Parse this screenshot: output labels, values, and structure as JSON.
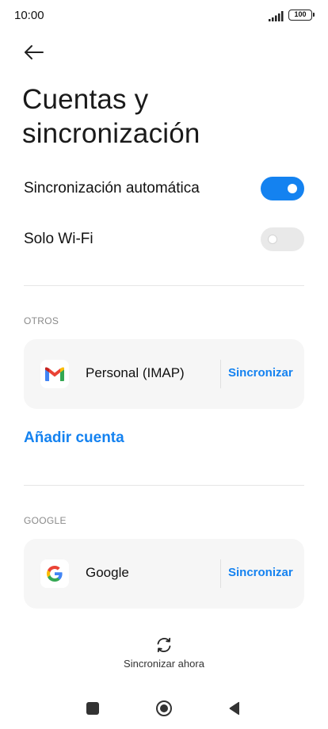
{
  "status_bar": {
    "time": "10:00",
    "battery": "100"
  },
  "header": {
    "back_icon": "arrow-left-icon",
    "title_line1": "Cuentas y",
    "title_line2": "sincronización"
  },
  "settings": {
    "auto_sync": {
      "label": "Sincronización automática",
      "enabled": true
    },
    "wifi_only": {
      "label": "Solo Wi-Fi",
      "enabled": false
    }
  },
  "sections": {
    "others": {
      "header": "OTROS",
      "account": {
        "icon": "gmail-icon",
        "name": "Personal (IMAP)",
        "sync_label": "Sincronizar"
      },
      "add_account_label": "Añadir cuenta"
    },
    "google": {
      "header": "GOOGLE",
      "account": {
        "icon": "google-icon",
        "name": "Google",
        "sync_label": "Sincronizar"
      }
    }
  },
  "sync_now": {
    "icon": "sync-icon",
    "label": "Sincronizar ahora"
  },
  "nav_bar": {
    "recents_icon": "square-icon",
    "home_icon": "circle-icon",
    "back_icon": "triangle-back-icon"
  },
  "colors": {
    "accent": "#1482f0",
    "card_background": "#f6f6f6",
    "toggle_off": "#e9e9e9"
  }
}
